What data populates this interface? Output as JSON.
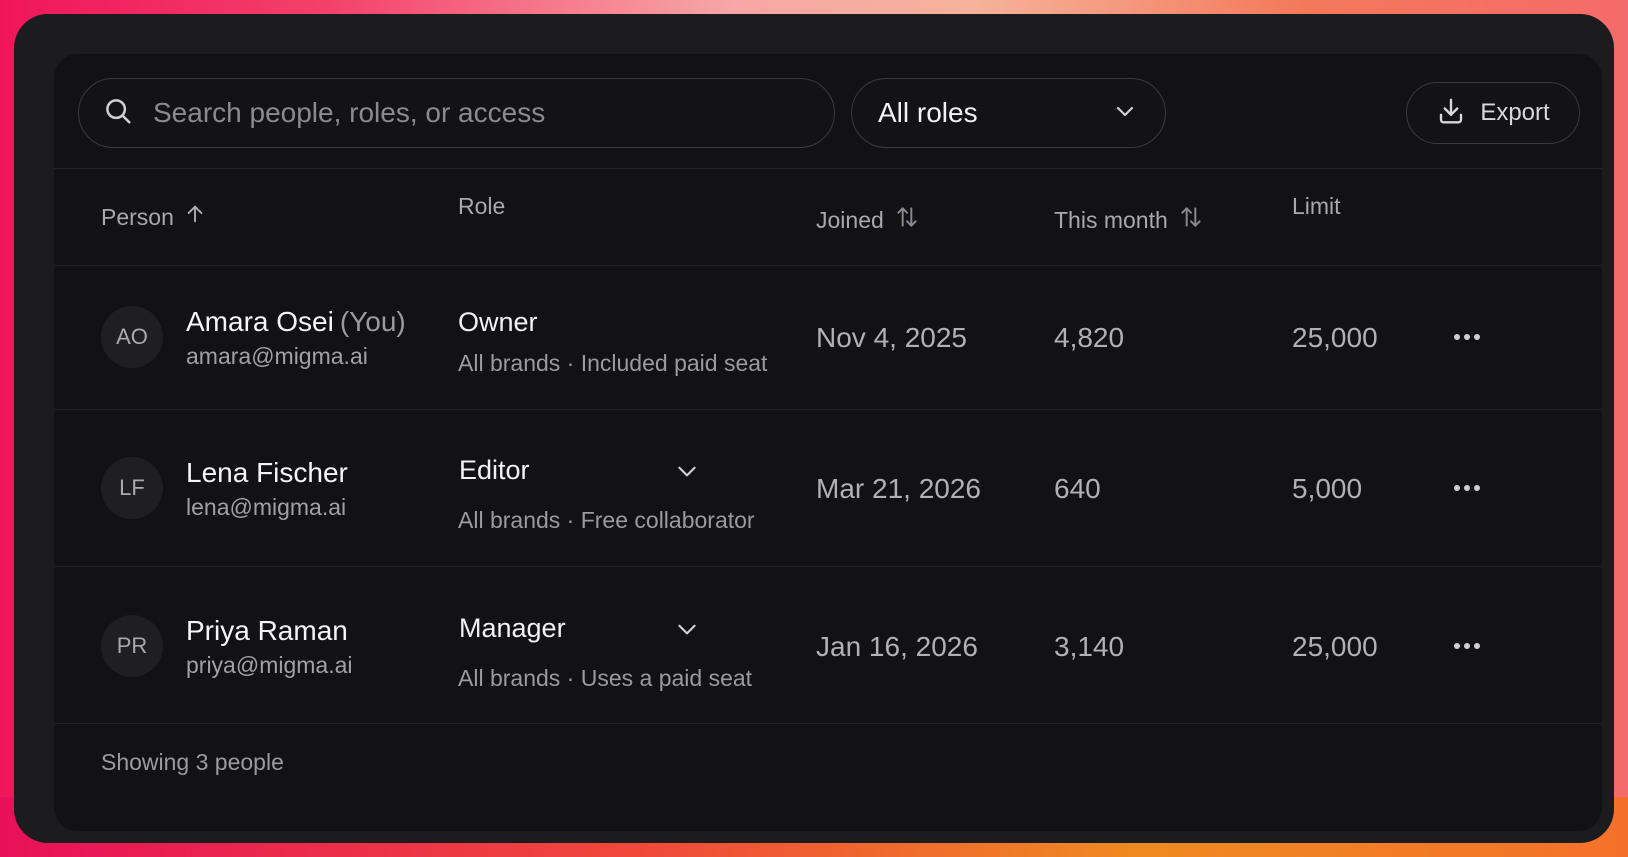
{
  "toolbar": {
    "search_placeholder": "Search people, roles, or access",
    "role_filter": "All roles",
    "export_label": "Export"
  },
  "table": {
    "headers": {
      "person": "Person",
      "role": "Role",
      "joined": "Joined",
      "this_month": "This month",
      "limit": "Limit"
    },
    "rows": [
      {
        "initials": "AO",
        "name": "Amara Osei",
        "you_tag": "(You)",
        "email": "amara@migma.ai",
        "role": "Owner",
        "role_detail": "All brands · Included paid seat",
        "joined": "Nov 4, 2025",
        "this_month": "4,820",
        "limit": "25,000"
      },
      {
        "initials": "LF",
        "name": "Lena Fischer",
        "email": "lena@migma.ai",
        "role": "Editor",
        "role_detail": "All brands · Free collaborator",
        "joined": "Mar 21, 2026",
        "this_month": "640",
        "limit": "5,000"
      },
      {
        "initials": "PR",
        "name": "Priya Raman",
        "email": "priya@migma.ai",
        "role": "Manager",
        "role_detail": "All brands · Uses a paid seat",
        "joined": "Jan 16, 2026",
        "this_month": "3,140",
        "limit": "25,000"
      }
    ]
  },
  "footer": {
    "count_text": "Showing 3 people"
  }
}
